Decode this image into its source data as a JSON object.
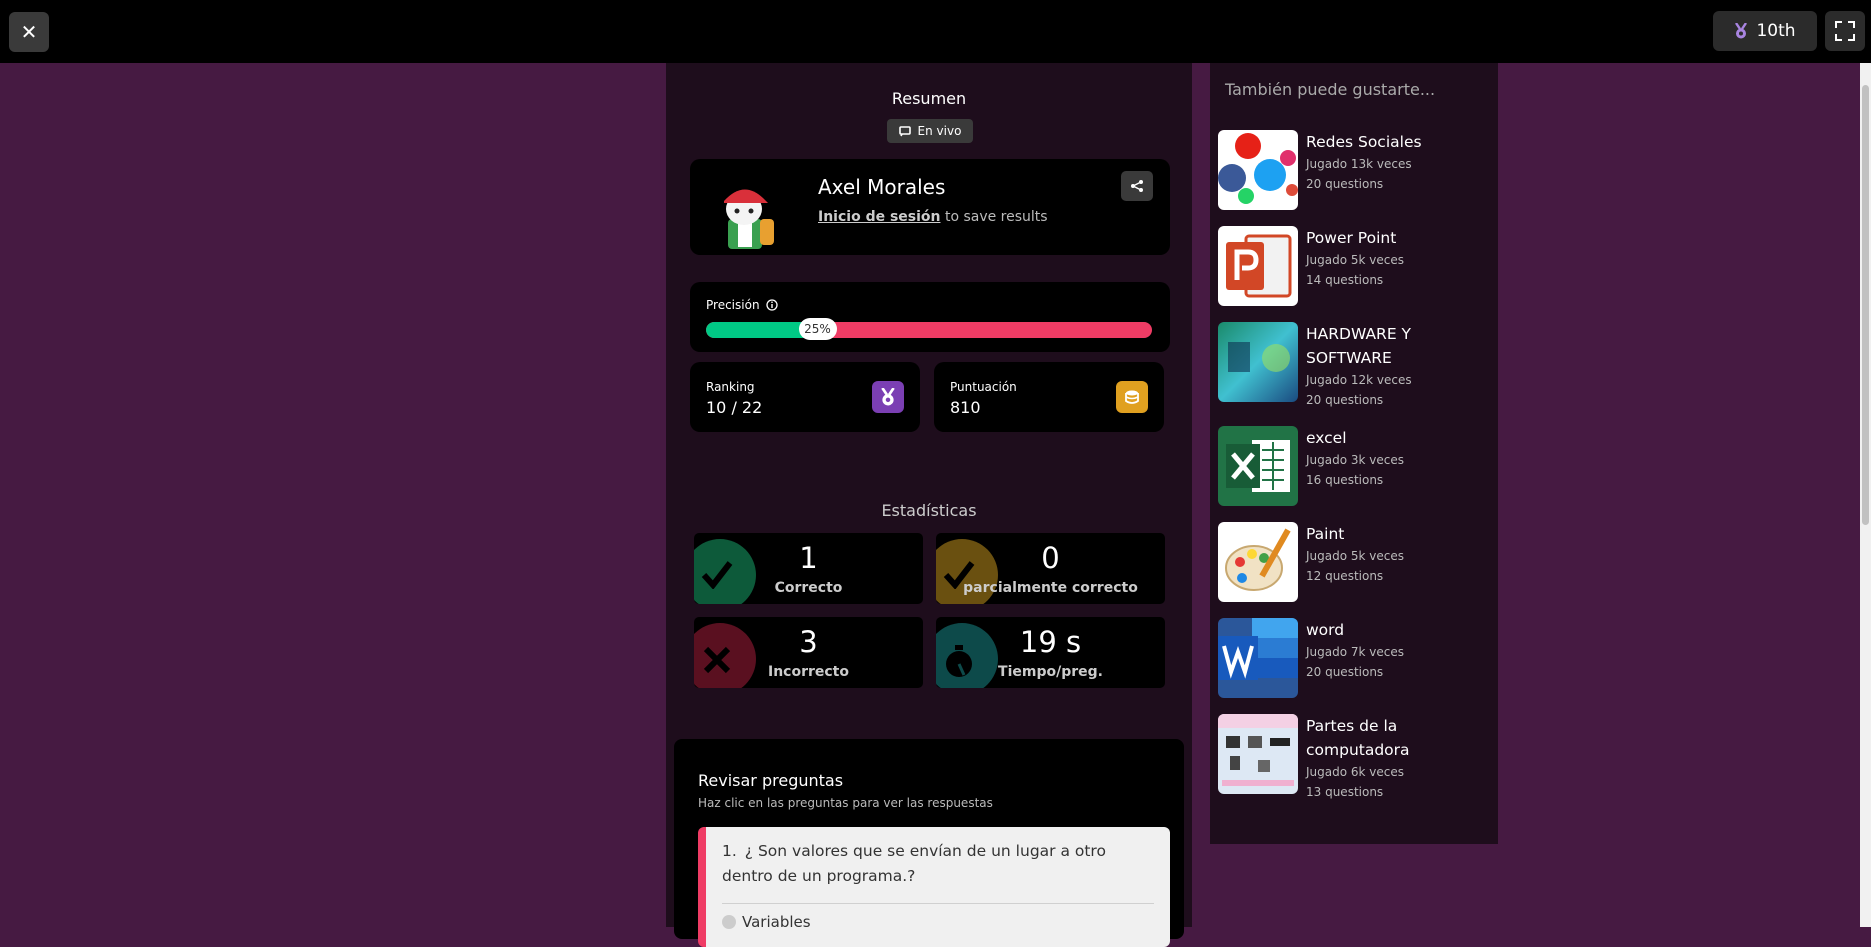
{
  "topbar": {
    "close_symbol": "✕",
    "rank_label": "10th",
    "medal_icon": "medal-icon",
    "fullscreen_icon": "fullscreen-icon"
  },
  "summary": {
    "title": "Resumen",
    "live_label": "En vivo"
  },
  "profile": {
    "name": "Axel Morales",
    "login_link": "Inicio de sesión",
    "login_suffix": " to save results"
  },
  "accuracy": {
    "label": "Precisión",
    "value_text": "25%",
    "fraction": 0.25,
    "colors": {
      "correct": "#00c985",
      "incorrect": "#ef3c65"
    }
  },
  "ranking": {
    "label": "Ranking",
    "value": "10 / 22",
    "badge_color": "#7b3fb3"
  },
  "score": {
    "label": "Puntuación",
    "value": "810",
    "badge_color": "#e0a020"
  },
  "stats": {
    "title": "Estadísticas",
    "correct": {
      "num": "1",
      "label": "Correcto",
      "color": "#0d5a3a"
    },
    "partial": {
      "num": "0",
      "label": "parcialmente correcto",
      "color": "#6a5010"
    },
    "incorrect": {
      "num": "3",
      "label": "Incorrecto",
      "color": "#5a1020"
    },
    "time": {
      "num": "19 s",
      "label": "Tiempo/preg.",
      "color": "#0d4a4a"
    }
  },
  "review": {
    "title": "Revisar preguntas",
    "subtitle": "Haz clic en las preguntas para ver las respuestas",
    "question": {
      "number": "1.",
      "text": "¿ Son valores que se envían de un lugar a otro dentro de un programa.?",
      "option": "Variables"
    }
  },
  "sidebar": {
    "title": "También puede gustarte...",
    "items": [
      {
        "title": "Redes Sociales",
        "played": "Jugado 13k veces",
        "questions": "20 questions"
      },
      {
        "title": "Power Point",
        "played": "Jugado 5k veces",
        "questions": "14 questions"
      },
      {
        "title": "HARDWARE Y SOFTWARE",
        "played": "Jugado 12k veces",
        "questions": "20 questions"
      },
      {
        "title": "excel",
        "played": "Jugado 3k veces",
        "questions": "16 questions"
      },
      {
        "title": "Paint",
        "played": "Jugado 5k veces",
        "questions": "12 questions"
      },
      {
        "title": "word",
        "played": "Jugado 7k veces",
        "questions": "20 questions"
      },
      {
        "title": "Partes de la computadora",
        "played": "Jugado 6k veces",
        "questions": "13 questions"
      }
    ]
  }
}
